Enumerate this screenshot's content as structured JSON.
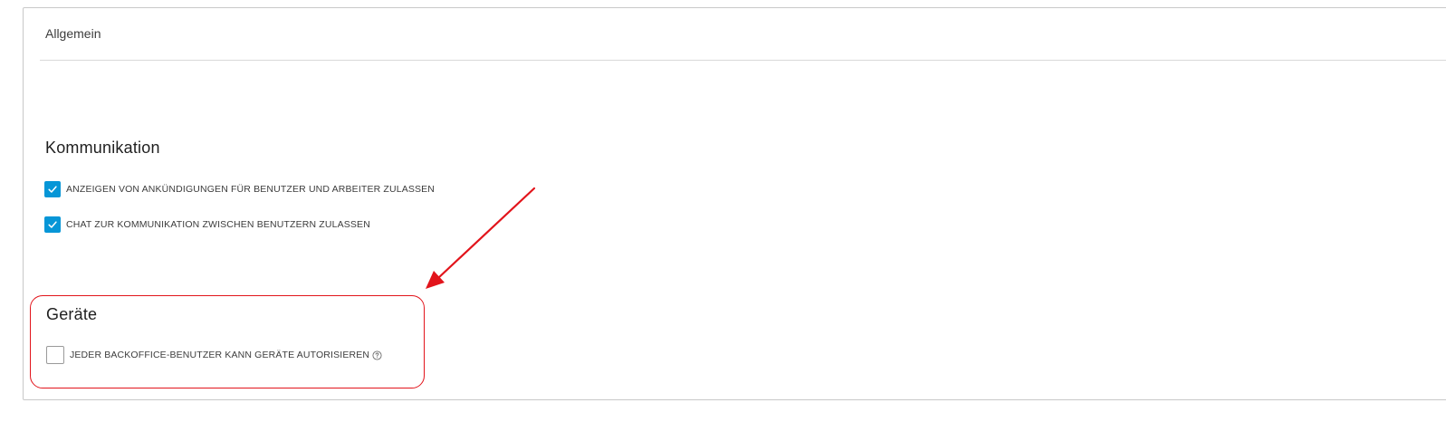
{
  "panel": {
    "header": "Allgemein"
  },
  "kommunikation": {
    "title": "Kommunikation",
    "options": [
      {
        "label": "ANZEIGEN VON ANKÜNDIGUNGEN FÜR BENUTZER UND ARBEITER ZULASSEN",
        "checked": true
      },
      {
        "label": "CHAT ZUR KOMMUNIKATION ZWISCHEN BENUTZERN ZULASSEN",
        "checked": true
      }
    ]
  },
  "geraete": {
    "title": "Geräte",
    "options": [
      {
        "label": "JEDER BACKOFFICE-BENUTZER KANN GERÄTE AUTORISIEREN",
        "checked": false,
        "help_icon": "question-circle-icon"
      }
    ]
  },
  "annotation": {
    "color": "#e2141b"
  },
  "colors": {
    "accent": "#0696d7"
  }
}
